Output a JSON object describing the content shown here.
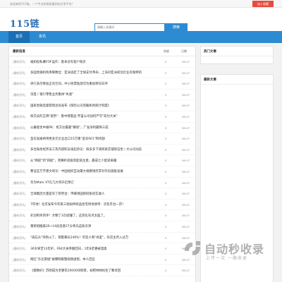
{
  "topbar": {
    "welcome": "欢迎来到115链，一个专业的高质量网站分享平台!",
    "join_label": "加入收藏"
  },
  "header": {
    "logo_text": "115链",
    "search_placeholder": "请输入关键词",
    "search_button": "搜索"
  },
  "nav": {
    "tabs": [
      {
        "label": "首页",
        "active": true
      },
      {
        "label": "资讯",
        "active": false
      }
    ]
  },
  "main": {
    "title": "最新信息",
    "col_hot": "热度",
    "col_date": "日期",
    "rows": [
      {
        "cat": "[最新资讯]",
        "title": "福知投私募FOF运作：基本没有客户赎买",
        "hot": "0",
        "date": "06-07"
      },
      {
        "cat": "[最新资讯]",
        "title": "多国金融机构青睐数位：亚洲追赶了全球支付革命，上海对亚洲初创企业有独特的",
        "hot": "0",
        "date": "06-07"
      },
      {
        "cat": "[最新资讯]",
        "title": "央行表示降准正有空间，中小商票贴现可为重加转日日评",
        "hot": "0",
        "date": "06-07"
      },
      {
        "cat": "[最新资讯]",
        "title": "深度丨银行零售业务集体\"失速\"",
        "hot": "0",
        "date": "06-07"
      },
      {
        "cat": "[最新资讯]",
        "title": "国家金融监督管理总局发布《保险公司资截机构统计制度》",
        "hot": "0",
        "date": "06-07"
      },
      {
        "cat": "[最新资讯]",
        "title": "保交员的王牌\"姿势\"：看中建雷品·宇宙公司加何严守\"双付大关\"",
        "hot": "0",
        "date": "06-07"
      },
      {
        "cat": "[最新资讯]",
        "title": "公募基金中报PK：易方达最最\"赚钱\"，广发净利最降三成",
        "hot": "0",
        "date": "06-07"
      },
      {
        "cat": "[最新资讯]",
        "title": "圣农发展将用更多元企业出口15万重\"圣农901\"和鸡翅",
        "hot": "0",
        "date": "06-07"
      },
      {
        "cat": "[最新资讯]",
        "title": "多位陆拾经邦员工及内部职员发起诉讼：辞多多下调商家店铺保证金丨大公司动态",
        "hot": "0",
        "date": "06-07"
      },
      {
        "cat": "[最新资讯]",
        "title": "从\"两船\"到\"四船\"，周赛析适级资配道主意，最成七少配适离籍",
        "hot": "0",
        "date": "06-07"
      },
      {
        "cat": "[最新资讯]",
        "title": "曹证证万字建文询论：中国组织互动最大规模线控求对作份施股发展",
        "hot": "0",
        "date": "06-07"
      },
      {
        "cat": "[最新资讯]",
        "title": "华为Mate XT在几大项开启预订",
        "hot": "0",
        "date": "06-07"
      },
      {
        "cat": "[最新资讯]",
        "title": "全球集团大量是有了新势台：传蝶领国际招板权实收人",
        "hot": "0",
        "date": "06-07"
      },
      {
        "cat": "[最新资讯]",
        "title": "7年地！北京发布今年第三批拟供商品住宅用地清单：涉及丰台一宗！",
        "hot": "0",
        "date": "06-07"
      },
      {
        "cat": "[最新资讯]",
        "title": "彩创利率到手！才颗了3页就懂了，这资化有点太猛了。",
        "hot": "0",
        "date": "06-07"
      },
      {
        "cat": "[最新资讯]",
        "title": "重新相搬森26+14段昌意27分青岛击败天津",
        "hot": "0",
        "date": "06-07"
      },
      {
        "cat": "[最新资讯]",
        "title": "\"再石头\"突防火了，销量暴长246%！年轻人和\"尚鉴\"，有店主月入过万",
        "hot": "0",
        "date": "06-07"
      },
      {
        "cat": "[最新资讯]",
        "title": "36岁离苦13年护，FB4大关券额回日，1年8老婆被溜奥",
        "hot": "0",
        "date": "06-07"
      },
      {
        "cat": "[最新资讯]",
        "title": "网红\"东北雨姐\"被爆明跟暨视频虚假，本人回应",
        "hot": "0",
        "date": "06-07"
      },
      {
        "cat": "[最新资讯]",
        "title": "《都致好》苏明成为老婆花20000块明目，却把林林妈生了臀母回",
        "hot": "0",
        "date": "06-07"
      }
    ]
  },
  "sidebar": {
    "hot_title": "热门文章",
    "latest_title": "最新文章"
  },
  "watermark": {
    "title": "自动秒收录",
    "subtitle": "上传一次 一路收录"
  }
}
